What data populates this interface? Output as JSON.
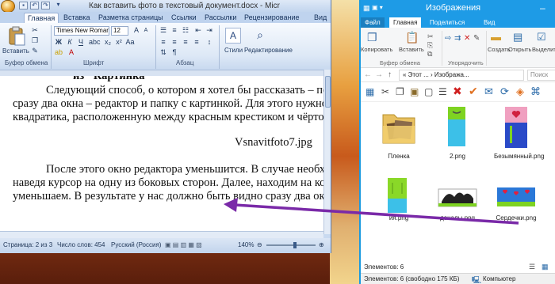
{
  "word": {
    "title": "Как вставить фото в текстовый документ.docx - Micr",
    "tabs": [
      "Главная",
      "Вставка",
      "Разметка страницы",
      "Ссылки",
      "Рассылки",
      "Рецензирование",
      "Вид"
    ],
    "active_tab": "Главная",
    "ribbon": {
      "paste_label": "Вставить",
      "font_name": "Times New Roman",
      "font_size": "12",
      "bold": "Ж",
      "italic": "К",
      "underline": "Ч",
      "styles_label": "Стили",
      "editing_label": "Редактирование",
      "groups": {
        "clipboard": "Буфер обмена",
        "font": "Шрифт",
        "paragraph": "Абзац"
      }
    },
    "document": {
      "heading_fragment": "из \"Картинка\"",
      "lines": [
        "Следующий способ, о котором я хотел бы рассказать – пере",
        "сразу два окна – редактор и папку с картинкой. Для этого нужно на",
        "квадратика, расположенную между красным крестиком и чёрточко",
        "Vsnavitfoto7.jpg",
        "После этого окно редактора уменьшится. В случае необходи",
        "наведя курсор на одну из боковых сторон. Далее, находим на комп",
        "уменьшаем. В результате у нас должно быть видно сразу два окна."
      ]
    },
    "status": {
      "page": "Страница: 2 из 3",
      "words": "Число слов: 454",
      "language": "Русский (Россия)",
      "zoom": "140%"
    }
  },
  "explorer": {
    "title": "Изображения",
    "tabs": [
      "Файл",
      "Главная",
      "Поделиться",
      "Вид"
    ],
    "active_tab": "Главная",
    "ribbon": {
      "copy": "Копировать",
      "paste": "Вставить",
      "group_clipboard": "Буфер обмена",
      "group_organize": "Упорядочить",
      "create": "Создать",
      "open": "Открыть",
      "select": "Выделить"
    },
    "breadcrumb": "« Этот ... › Изобража...",
    "search_placeholder": "Поиск",
    "files": [
      {
        "name": "Пленка",
        "kind": "folder"
      },
      {
        "name": "2.png",
        "kind": "image"
      },
      {
        "name": "Безымянный.png",
        "kind": "image"
      },
      {
        "name": "ия.png",
        "kind": "image"
      },
      {
        "name": "доналы.png",
        "kind": "image"
      },
      {
        "name": "Сердечки.png",
        "kind": "image"
      }
    ],
    "status_items": "Элементов: 6",
    "bottom_status": "Элементов: 6 (свободно 175 КБ)",
    "computer_label": "Компьютер"
  },
  "colors": {
    "explorer_accent": "#1e9be6",
    "arrow": "#7a2aa8",
    "word_frame": "#c9daf0"
  }
}
